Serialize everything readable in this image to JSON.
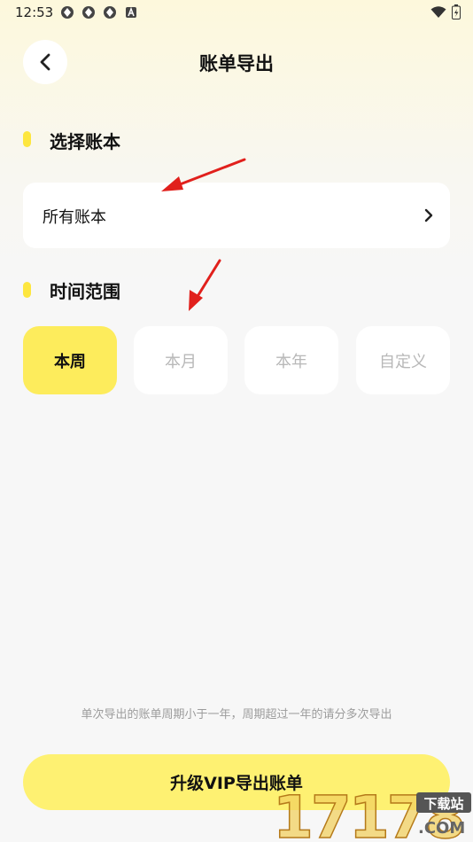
{
  "status_bar": {
    "time": "12:53"
  },
  "header": {
    "title": "账单导出"
  },
  "sections": {
    "account": {
      "title": "选择账本",
      "selected": "所有账本"
    },
    "time_range": {
      "title": "时间范围",
      "options": [
        {
          "label": "本周",
          "active": true
        },
        {
          "label": "本月",
          "active": false
        },
        {
          "label": "本年",
          "active": false
        },
        {
          "label": "自定义",
          "active": false
        }
      ]
    }
  },
  "footer": {
    "note": "单次导出的账单周期小于一年，周期超过一年的请分多次导出",
    "button_label": "升级VIP导出账单"
  },
  "watermark": {
    "brand_number": "17178",
    "brand_sub": "下载站",
    "brand_domain": ".COM"
  },
  "colors": {
    "accent_yellow": "#fdec5c",
    "button_yellow": "#fef172",
    "arrow_red": "#e1201c"
  }
}
